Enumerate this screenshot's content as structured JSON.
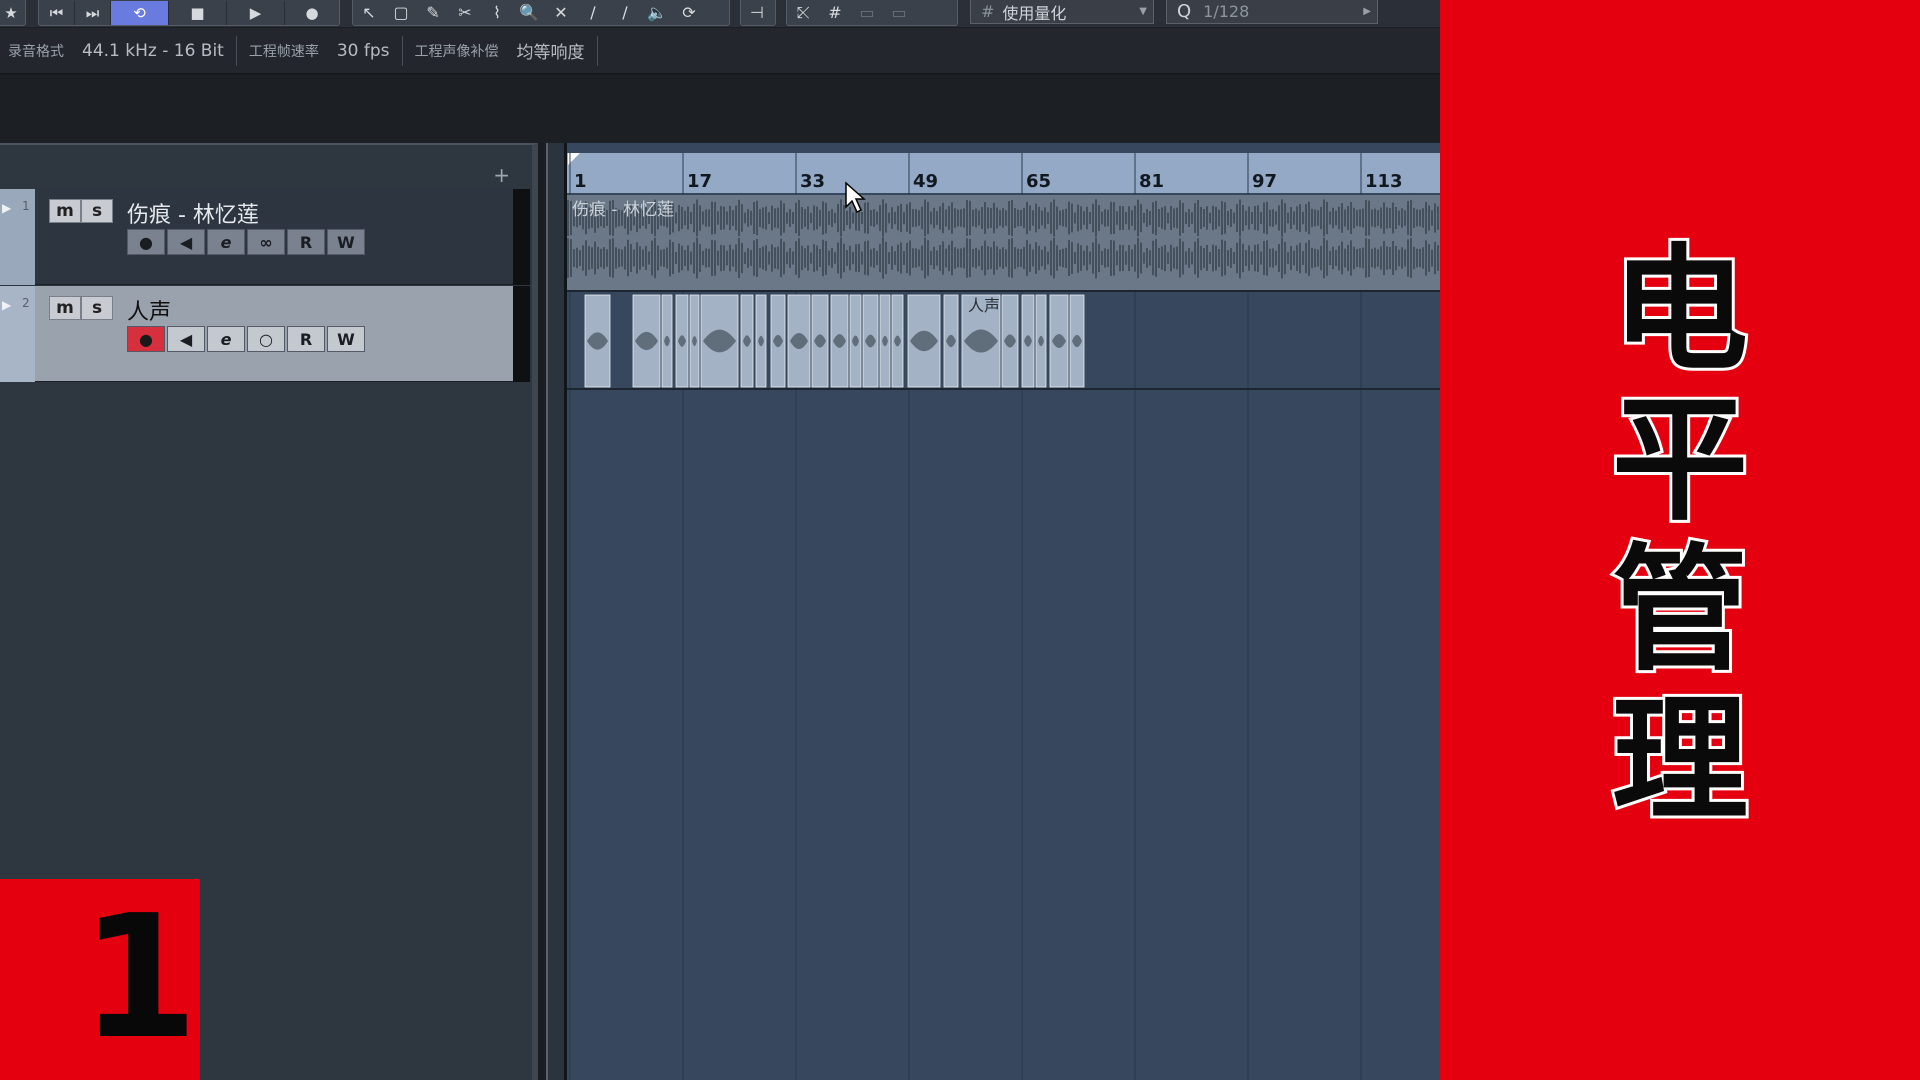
{
  "toolbar": {
    "transport": [
      "⏮",
      "⏭",
      "⟲",
      "■",
      "▶",
      "●"
    ],
    "tools": [
      "↖",
      "▢",
      "✎",
      "✂",
      "⌇",
      "🔍",
      "✕",
      "∕",
      "∕",
      "🔈",
      "⟳"
    ],
    "snap_icons": [
      "⤪",
      "#"
    ],
    "quantize_type": "使用量化",
    "quantize_prefix": "Q",
    "quantize_value": "1/128"
  },
  "info_line": [
    {
      "label": "录音格式",
      "value": "44.1 kHz - 16 Bit"
    },
    {
      "label": "工程帧速率",
      "value": "30 fps"
    },
    {
      "label": "工程声像补偿",
      "value": "均等响度"
    }
  ],
  "track_list": {
    "add_label": "+",
    "tracks": [
      {
        "number": "1",
        "name": "伤痕 - 林忆莲",
        "mute": "m",
        "solo": "s",
        "buttons": [
          "●",
          "◀",
          "e",
          "∞",
          "R",
          "W"
        ]
      },
      {
        "number": "2",
        "name": "人声",
        "mute": "m",
        "solo": "s",
        "buttons": [
          "●",
          "◀",
          "e",
          "○",
          "R",
          "W"
        ]
      }
    ]
  },
  "ruler": {
    "bars": [
      "1",
      "17",
      "33",
      "49",
      "65",
      "81",
      "97",
      "113"
    ]
  },
  "events": {
    "track1_event_label": "伤痕 - 林忆莲",
    "track2_event_label": "人声"
  },
  "overlay": {
    "title_chars": [
      "电",
      "平",
      "管",
      "理"
    ],
    "episode_number": "1",
    "accent_color": "#e5000f"
  }
}
